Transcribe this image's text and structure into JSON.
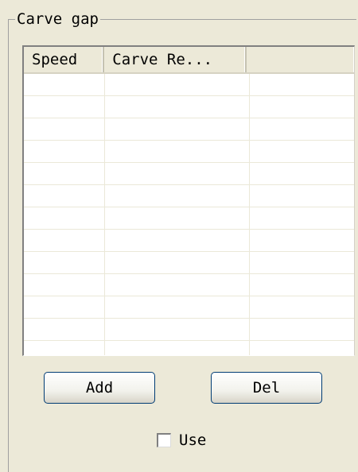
{
  "group": {
    "title": "Carve gap"
  },
  "table": {
    "columns": [
      "Speed",
      "Carve Re...",
      ""
    ],
    "rows": []
  },
  "buttons": {
    "add_label": "Add",
    "del_label": "Del"
  },
  "use_checkbox": {
    "label": "Use",
    "checked": false
  }
}
